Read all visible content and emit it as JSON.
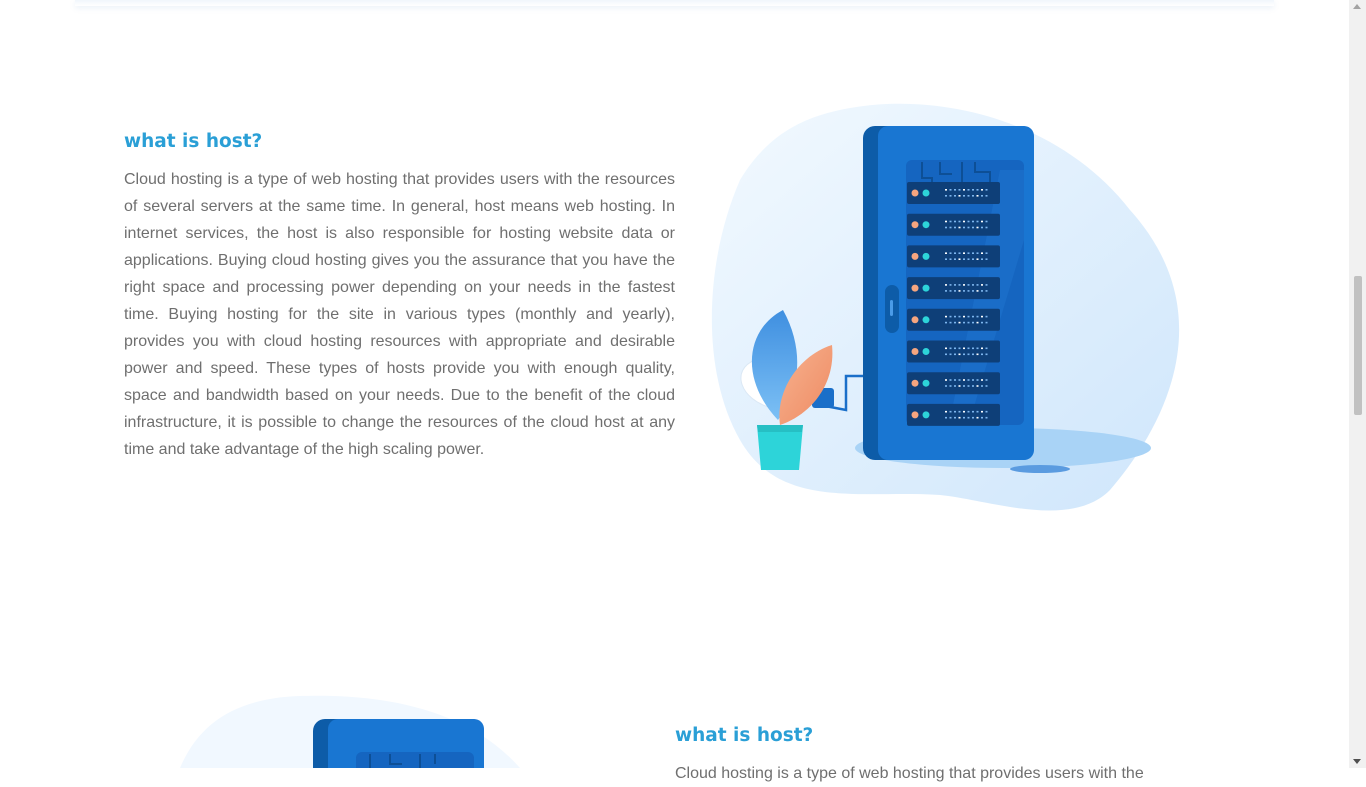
{
  "sections": [
    {
      "heading": "what is host?",
      "body": "Cloud hosting is a type of web hosting that provides users with the resources of several servers at the same time. In general, host means web hosting. In internet services, the host is also responsible for hosting website data or applications. Buying cloud hosting gives you the assurance that you have the right space and processing power depending on your needs in the fastest time. Buying hosting for the site in various types (monthly and yearly), provides you with cloud hosting resources with appropriate and desirable power and speed. These types of hosts provide you with enough quality, space and bandwidth based on your needs. Due to the benefit of the cloud infrastructure, it is possible to change the resources of the cloud host at any time and take advantage of the high scaling power.",
      "illustration": "server-rack-illustration"
    },
    {
      "heading": "what is host?",
      "body": "Cloud hosting is a type of web hosting that provides users with the",
      "illustration": "server-rack-illustration"
    }
  ],
  "colors": {
    "heading": "#2a9fd6",
    "body_text": "#6f6f6f",
    "rack_blue": "#1976d2",
    "rack_dark": "#0d5ca8",
    "blob": "#e3f1fd",
    "plant_orange": "#f5a57f",
    "pot_cyan": "#2dd4d9"
  }
}
